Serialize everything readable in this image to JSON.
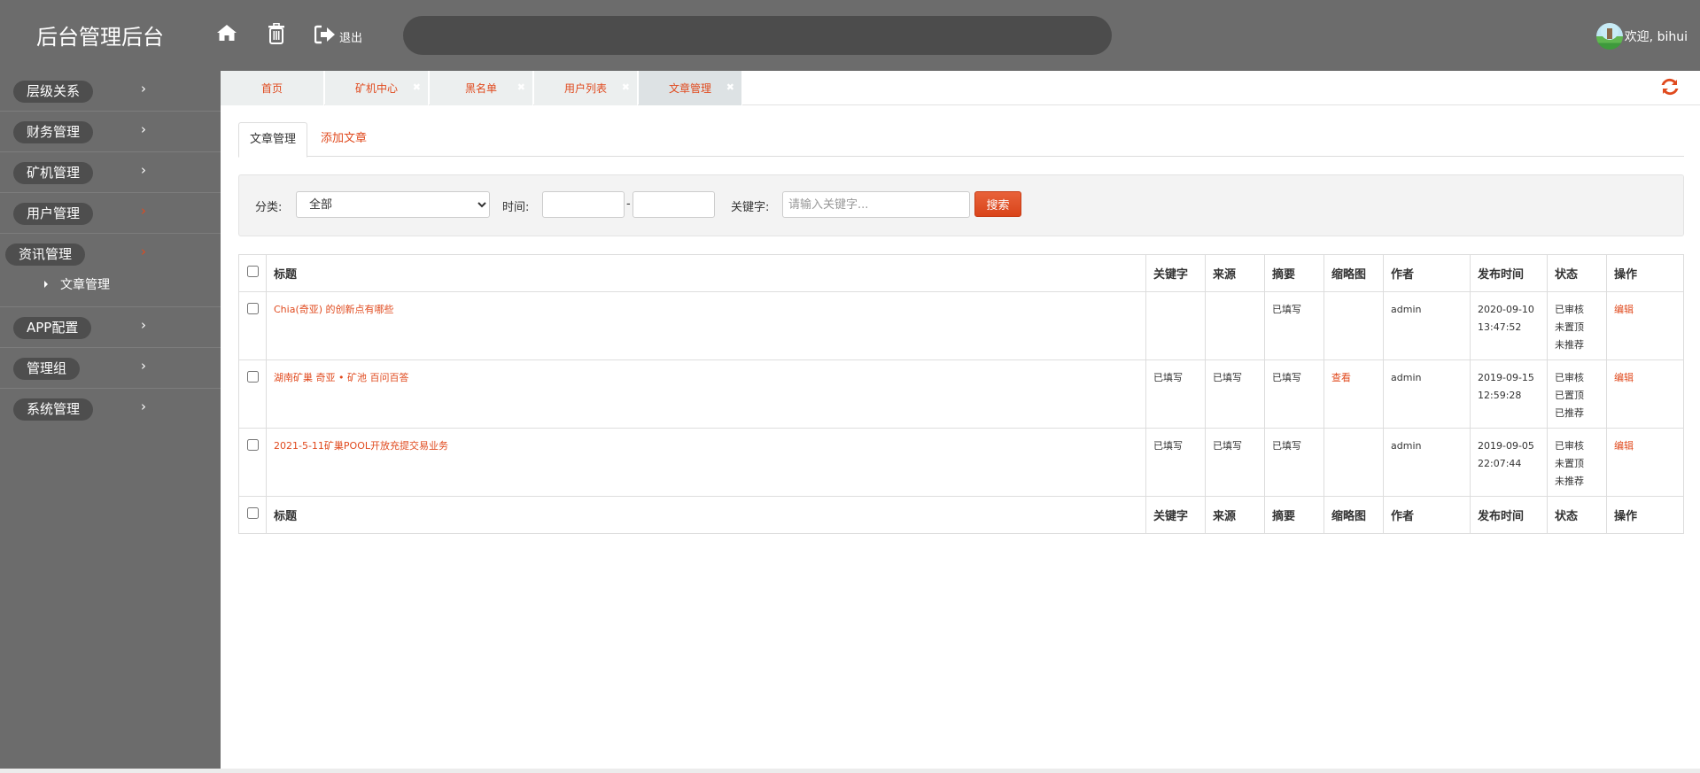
{
  "header": {
    "brand": "后台管理后台",
    "logout_label": "退出",
    "welcome": "欢迎, bihui",
    "icons": [
      "home-icon",
      "trash-icon",
      "logout-icon"
    ]
  },
  "sidebar": {
    "items": [
      {
        "label": "层级关系",
        "active": false
      },
      {
        "label": "财务管理",
        "active": false
      },
      {
        "label": "矿机管理",
        "active": false
      },
      {
        "label": "用户管理",
        "active": true
      },
      {
        "label": "资讯管理",
        "active": true,
        "children": [
          {
            "label": "文章管理"
          }
        ]
      },
      {
        "label": "APP配置",
        "active": false
      },
      {
        "label": "管理组",
        "active": false
      },
      {
        "label": "系统管理",
        "active": false
      }
    ]
  },
  "tabs": [
    {
      "label": "首页",
      "closable": false
    },
    {
      "label": "矿机中心",
      "closable": true
    },
    {
      "label": "黑名单",
      "closable": true
    },
    {
      "label": "用户列表",
      "closable": true
    },
    {
      "label": "文章管理",
      "closable": true,
      "active": true
    }
  ],
  "subtabs": {
    "active": "文章管理",
    "add": "添加文章"
  },
  "filter": {
    "category_label": "分类:",
    "category_value": "全部",
    "time_label": "时间:",
    "time_sep": "-",
    "start_value": "",
    "end_value": "",
    "keyword_label": "关键字:",
    "keyword_placeholder": "请输入关键字...",
    "search_button": "搜索"
  },
  "table": {
    "columns": [
      "标题",
      "关键字",
      "来源",
      "摘要",
      "缩略图",
      "作者",
      "发布时间",
      "状态",
      "操作"
    ],
    "rows": [
      {
        "title": "Chia(奇亚) 的创新点有哪些",
        "keyword": "",
        "source": "",
        "summary": "已填写",
        "thumb": "",
        "author": "admin",
        "date": "2020-09-10",
        "time": "13:47:52",
        "status": [
          "已审核",
          "未置顶",
          "未推荐"
        ],
        "action": "编辑"
      },
      {
        "title": "湖南矿巢 奇亚 • 矿池 百问百答",
        "keyword": "已填写",
        "source": "已填写",
        "summary": "已填写",
        "thumb": "查看",
        "author": "admin",
        "date": "2019-09-15",
        "time": "12:59:28",
        "status": [
          "已审核",
          "已置顶",
          "已推荐"
        ],
        "action": "编辑"
      },
      {
        "title": "2021-5-11矿巢POOL开放充提交易业务",
        "keyword": "已填写",
        "source": "已填写",
        "summary": "已填写",
        "thumb": "",
        "author": "admin",
        "date": "2019-09-05",
        "time": "22:07:44",
        "status": [
          "已审核",
          "未置顶",
          "未推荐"
        ],
        "action": "编辑"
      }
    ]
  },
  "colors": {
    "accent": "#e04a1e",
    "header_bg": "#6c6c6c",
    "pill_bg": "#4e4e4e",
    "search_bg": "#4c4c4c"
  }
}
